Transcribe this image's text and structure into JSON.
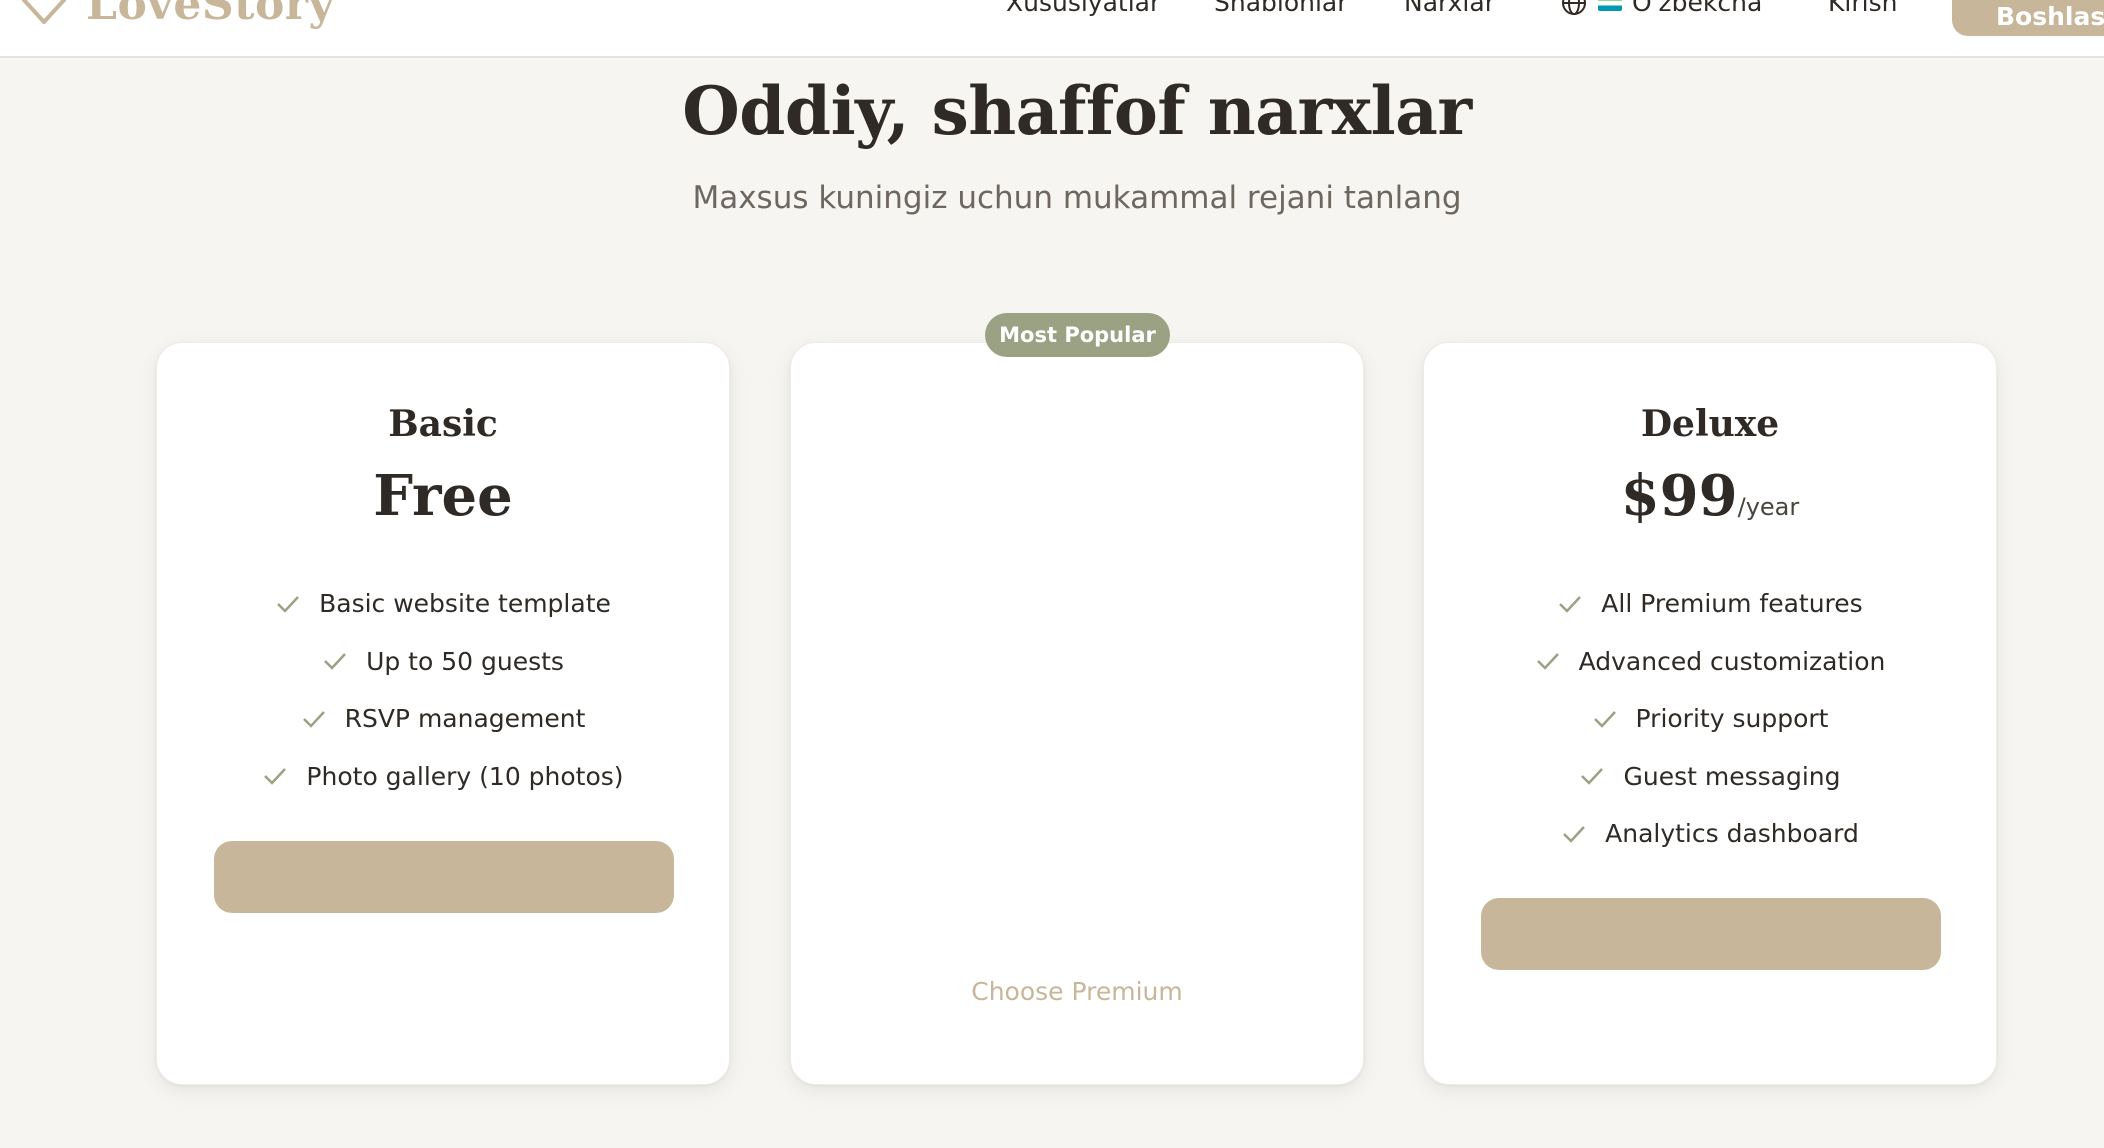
{
  "brand": {
    "name": "LoveStory",
    "accent": "#c8b69a"
  },
  "nav": {
    "items": [
      "Xususiyatlar",
      "Shablonlar",
      "Narxlar"
    ],
    "language": "O'zbekcha",
    "login": "Kirish",
    "start": "Boshlash"
  },
  "hero": {
    "title": "Oddiy, shaffof narxlar",
    "subtitle": "Maxsus kuningiz uchun mukammal rejani tanlang"
  },
  "plans": [
    {
      "name": "Basic",
      "price": "Free",
      "features": [
        "Basic website template",
        "Up to 50 guests",
        "RSVP management",
        "Photo gallery (10 photos)"
      ],
      "cta": ""
    },
    {
      "badge": "Most Popular",
      "cta": "Choose Premium"
    },
    {
      "name": "Deluxe",
      "price": "$99",
      "period": "/year",
      "features": [
        "All Premium features",
        "Advanced customization",
        "Priority support",
        "Guest messaging",
        "Analytics dashboard"
      ],
      "cta": ""
    }
  ],
  "colors": {
    "background": "#f6f5f1",
    "badge": "#9aa283",
    "check": "#9aa283",
    "text": "#2f2a25"
  },
  "icons": {
    "logo": "heart-outline-icon",
    "language": "globe-icon",
    "flag": "uzbekistan-flag-icon",
    "feature": "check-icon"
  }
}
